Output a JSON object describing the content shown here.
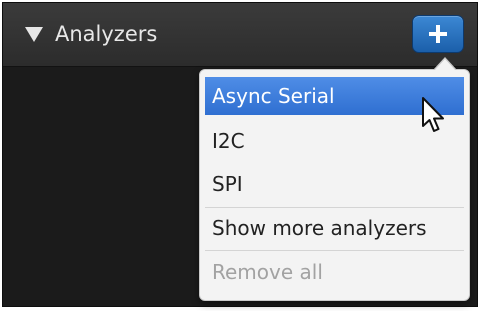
{
  "panel": {
    "title": "Analyzers",
    "collapse_icon": "triangle-down-icon",
    "add_icon": "plus-icon"
  },
  "menu": {
    "items": [
      {
        "label": "Async Serial",
        "state": "selected"
      },
      {
        "label": "I2C",
        "state": "normal"
      },
      {
        "label": "SPI",
        "state": "normal"
      },
      {
        "label": "Show more analyzers",
        "state": "normal"
      },
      {
        "label": "Remove all",
        "state": "disabled"
      }
    ]
  },
  "colors": {
    "panel_bg": "#1b1b1b",
    "header_bg": "#2c2c2c",
    "button_blue": "#1b5faa",
    "selection_blue": "#2f6fd1",
    "menu_bg": "#f3f3f3",
    "disabled_text": "#a2a2a2"
  },
  "cursor": "arrow-cursor-icon"
}
